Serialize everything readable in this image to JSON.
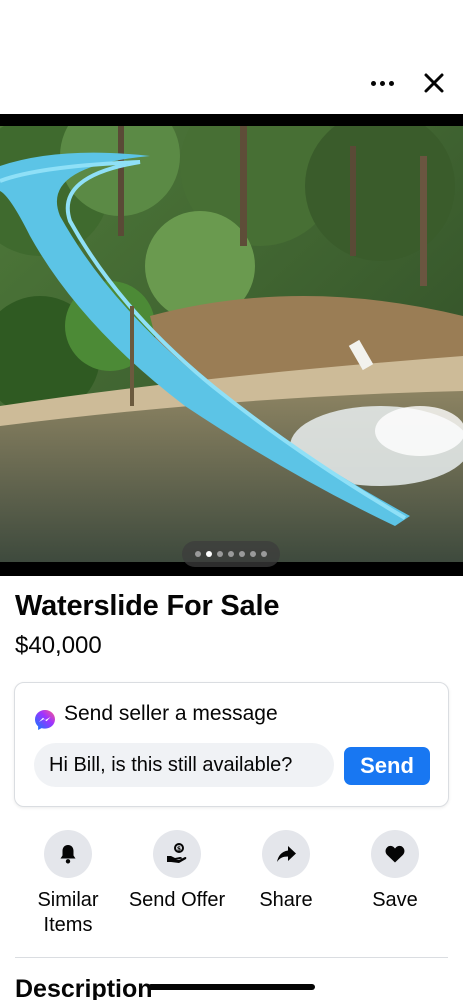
{
  "header": {
    "more_icon": "more-horizontal-icon",
    "close_icon": "close-icon"
  },
  "photo": {
    "description_icon": "photo",
    "page_count": 7,
    "current_page": 2
  },
  "listing": {
    "title": "Waterslide For Sale",
    "price": "$40,000"
  },
  "message_card": {
    "icon": "messenger-icon",
    "heading": "Send seller a message",
    "input_value": "Hi Bill, is this still available?",
    "send_label": "Send",
    "accent_color": "#1877f2"
  },
  "actions": [
    {
      "icon": "bell-icon",
      "label_line1": "Similar",
      "label_line2": "Items"
    },
    {
      "icon": "send-offer-icon",
      "label_line1": "Send Offer",
      "label_line2": ""
    },
    {
      "icon": "share-icon",
      "label_line1": "Share",
      "label_line2": ""
    },
    {
      "icon": "heart-icon",
      "label_line1": "Save",
      "label_line2": ""
    }
  ],
  "description": {
    "heading": "Description"
  }
}
